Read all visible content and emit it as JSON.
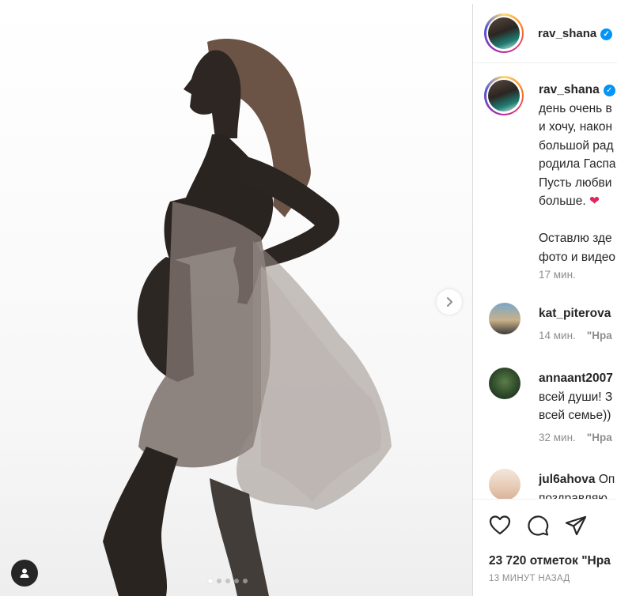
{
  "post": {
    "author": "rav_shana",
    "verified": true,
    "image_alt": "Silhouette of a pregnant woman in a sheer flowing dress",
    "carousel": {
      "total": 5,
      "current": 1
    }
  },
  "caption": {
    "username": "rav_shana",
    "lines": [
      "день очень в",
      "и хочу, након",
      "большой рад",
      "родила Гаспа",
      "Пусть любви",
      "больше."
    ],
    "heart": "❤",
    "lines2": [
      "Оставлю зде",
      "фото и видео"
    ],
    "time": "17 мин."
  },
  "comments": [
    {
      "username": "kat_piterova",
      "text": "",
      "lines": [],
      "time": "14 мин.",
      "reply": "\"Нра"
    },
    {
      "username": "annaant2007",
      "text": "",
      "lines": [
        "всей души! З",
        "всей семье))"
      ],
      "time": "32 мин.",
      "reply": "\"Нра"
    },
    {
      "username": "jul6ahova",
      "text": "Оп",
      "lines": [
        "поздравляю"
      ],
      "time": "",
      "reply": ""
    }
  ],
  "actions": {
    "likes": "23 720 отметок \"Нра",
    "timestamp": "13 МИНУТ НАЗАД"
  },
  "icons": [
    "chevron-right-icon",
    "user-tag-icon",
    "heart-icon",
    "comment-icon",
    "share-icon",
    "verified-icon"
  ],
  "colors": {
    "verified": "#0095f6",
    "heart": "#e0245e",
    "muted": "#8e8e8e"
  }
}
